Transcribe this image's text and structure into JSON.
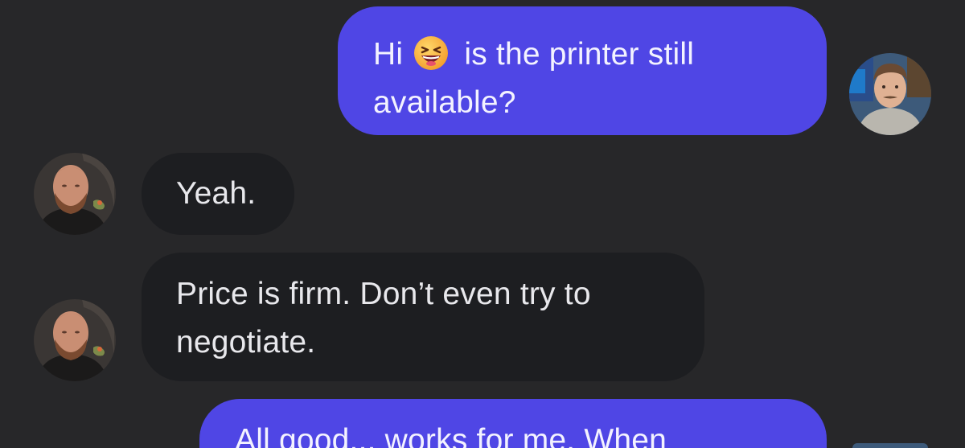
{
  "conversation": {
    "messages": [
      {
        "sender": "me",
        "text_before_emoji": "Hi",
        "emoji": "grinning-squinting-face",
        "text_line1_after_emoji": "is the printer still",
        "text_line2": "available?"
      },
      {
        "sender": "seller",
        "text": "Yeah."
      },
      {
        "sender": "seller",
        "text_line1": "Price is firm. Don’t even try to",
        "text_line2": "negotiate."
      },
      {
        "sender": "me",
        "text_line1": "All good... works for me. When"
      }
    ]
  },
  "colors": {
    "background": "#272729",
    "outgoing_bubble": "#4f46e5",
    "incoming_bubble": "#1d1e21"
  }
}
